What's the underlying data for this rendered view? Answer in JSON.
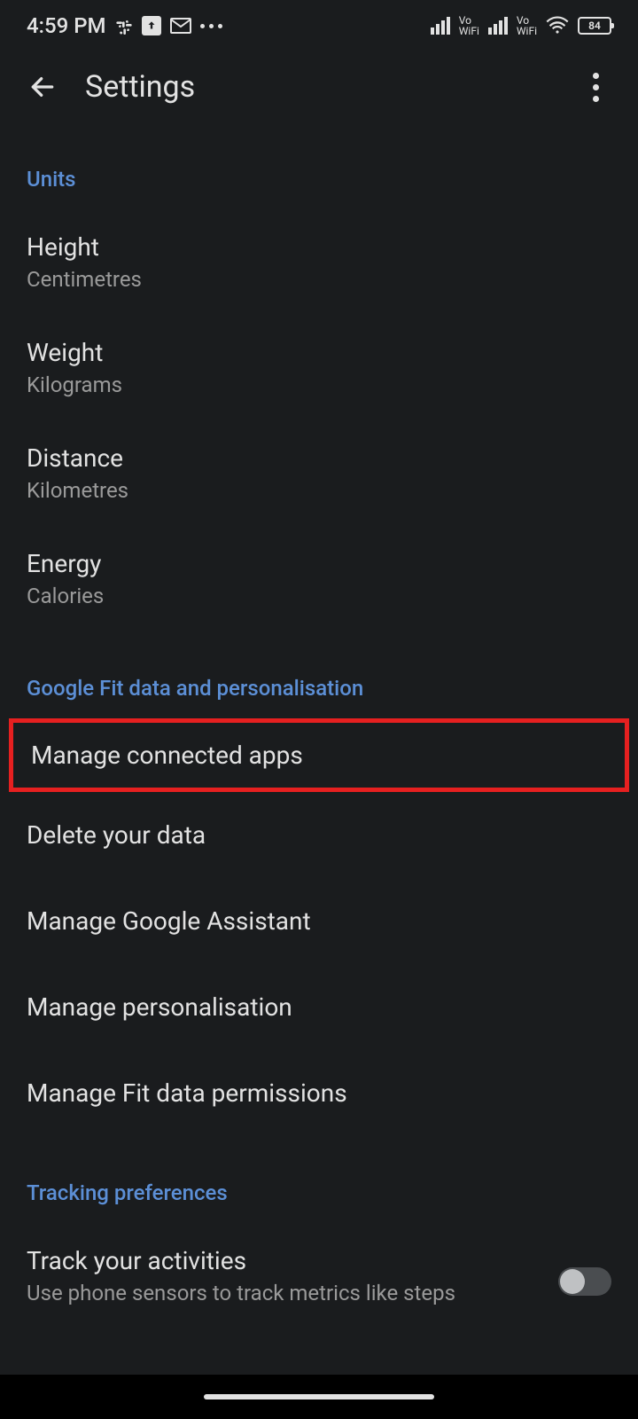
{
  "status": {
    "time": "4:59 PM",
    "vowifi_top": "Vo",
    "vowifi_bottom": "WiFi",
    "battery": "84"
  },
  "header": {
    "title": "Settings"
  },
  "sections": {
    "units": {
      "header": "Units",
      "items": [
        {
          "title": "Height",
          "subtitle": "Centimetres"
        },
        {
          "title": "Weight",
          "subtitle": "Kilograms"
        },
        {
          "title": "Distance",
          "subtitle": "Kilometres"
        },
        {
          "title": "Energy",
          "subtitle": "Calories"
        }
      ]
    },
    "data": {
      "header": "Google Fit data and personalisation",
      "items": [
        {
          "title": "Manage connected apps"
        },
        {
          "title": "Delete your data"
        },
        {
          "title": "Manage Google Assistant"
        },
        {
          "title": "Manage personalisation"
        },
        {
          "title": "Manage Fit data permissions"
        }
      ]
    },
    "tracking": {
      "header": "Tracking preferences",
      "item": {
        "title": "Track your activities",
        "subtitle": "Use phone sensors to track metrics like steps"
      }
    }
  }
}
